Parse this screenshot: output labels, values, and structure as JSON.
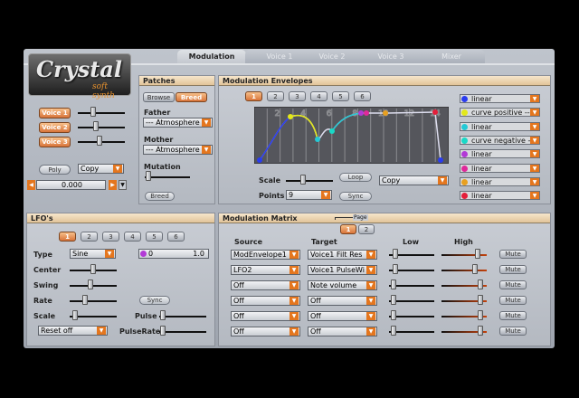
{
  "logo": {
    "title": "Crystal",
    "subtitle": "soft synth"
  },
  "tabs": [
    {
      "label": "Modulation",
      "active": true
    },
    {
      "label": "Voice 1"
    },
    {
      "label": "Voice 2"
    },
    {
      "label": "Voice 3"
    },
    {
      "label": "Mixer"
    }
  ],
  "voices": [
    {
      "label": "Voice 1"
    },
    {
      "label": "Voice 2"
    },
    {
      "label": "Voice 3"
    }
  ],
  "poly_label": "Poly",
  "copy_label": "Copy",
  "value_readout": "0.000",
  "patches": {
    "title": "Patches",
    "browse": "Browse",
    "breed": "Breed",
    "father_label": "Father",
    "father_value": "--- Atmosphere",
    "mother_label": "Mother",
    "mother_value": "--- Atmosphere",
    "mutation_label": "Mutation",
    "breed_button": "Breed"
  },
  "mod_env": {
    "title": "Modulation Envelopes",
    "tabs": [
      "1",
      "2",
      "3",
      "4",
      "5",
      "6"
    ],
    "grid_numbers": [
      "2",
      "4",
      "6",
      "8",
      "10",
      "12",
      "14"
    ],
    "scale_label": "Scale",
    "points_label": "Points",
    "points_value": "9",
    "loop_label": "Loop",
    "sync_label": "Sync",
    "copy_value": "Copy",
    "curves": [
      {
        "label": "linear",
        "color": "#2a3cf0"
      },
      {
        "label": "curve positive --",
        "color": "#e3e81a"
      },
      {
        "label": "linear",
        "color": "#24c9d6"
      },
      {
        "label": "curve negative --",
        "color": "#19d9c7"
      },
      {
        "label": "linear",
        "color": "#b23ad6"
      },
      {
        "label": "linear",
        "color": "#e0299a"
      },
      {
        "label": "linear",
        "color": "#e8a020"
      },
      {
        "label": "linear",
        "color": "#e41e3a"
      }
    ]
  },
  "lfo": {
    "title": "LFO's",
    "tabs": [
      "1",
      "2",
      "3",
      "4",
      "5",
      "6"
    ],
    "type_label": "Type",
    "type_value": "Sine",
    "range_min": "0",
    "range_max": "1.0",
    "center_label": "Center",
    "swing_label": "Swing",
    "rate_label": "Rate",
    "sync_label": "Sync",
    "scale_label": "Scale",
    "pulse_label": "Pulse",
    "pulserate_label": "PulseRate",
    "reset_value": "Reset off"
  },
  "matrix": {
    "title": "Modulation Matrix",
    "page_label": "Page",
    "pages": [
      "1",
      "2"
    ],
    "col_source": "Source",
    "col_target": "Target",
    "col_low": "Low",
    "col_high": "High",
    "rows": [
      {
        "source": "ModEnvelope1",
        "target": "Voice1 Filt Res",
        "mute": "Mute",
        "low": 0.1,
        "high": 0.85
      },
      {
        "source": "LFO2",
        "target": "Voice1 PulseWi",
        "mute": "Mute",
        "low": 0.08,
        "high": 0.78
      },
      {
        "source": "Off",
        "target": "Note volume",
        "mute": "Mute",
        "low": 0.05,
        "high": 0.92
      },
      {
        "source": "Off",
        "target": "Off",
        "mute": "Mute",
        "low": 0.05,
        "high": 0.92
      },
      {
        "source": "Off",
        "target": "Off",
        "mute": "Mute",
        "low": 0.05,
        "high": 0.92
      },
      {
        "source": "Off",
        "target": "Off",
        "mute": "Mute",
        "low": 0.05,
        "high": 0.92
      }
    ]
  }
}
